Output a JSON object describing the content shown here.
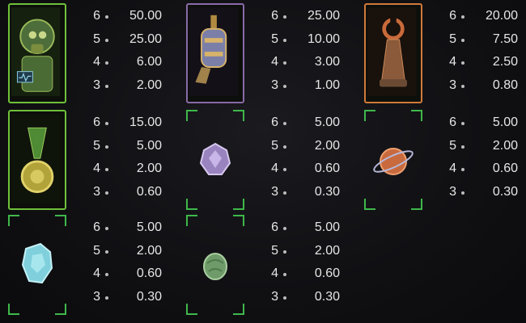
{
  "symbols": [
    {
      "name": "robot-diver",
      "pays": [
        {
          "count": "6",
          "value": "50.00"
        },
        {
          "count": "5",
          "value": "25.00"
        },
        {
          "count": "4",
          "value": "6.00"
        },
        {
          "count": "3",
          "value": "2.00"
        }
      ]
    },
    {
      "name": "lantern-device",
      "pays": [
        {
          "count": "6",
          "value": "25.00"
        },
        {
          "count": "5",
          "value": "10.00"
        },
        {
          "count": "4",
          "value": "3.00"
        },
        {
          "count": "3",
          "value": "1.00"
        }
      ]
    },
    {
      "name": "copper-tower",
      "pays": [
        {
          "count": "6",
          "value": "20.00"
        },
        {
          "count": "5",
          "value": "7.50"
        },
        {
          "count": "4",
          "value": "2.50"
        },
        {
          "count": "3",
          "value": "0.80"
        }
      ]
    },
    {
      "name": "green-medal",
      "pays": [
        {
          "count": "6",
          "value": "15.00"
        },
        {
          "count": "5",
          "value": "5.00"
        },
        {
          "count": "4",
          "value": "2.00"
        },
        {
          "count": "3",
          "value": "0.60"
        }
      ]
    },
    {
      "name": "purple-crystal",
      "pays": [
        {
          "count": "6",
          "value": "5.00"
        },
        {
          "count": "5",
          "value": "2.00"
        },
        {
          "count": "4",
          "value": "0.60"
        },
        {
          "count": "3",
          "value": "0.30"
        }
      ]
    },
    {
      "name": "orange-planet",
      "pays": [
        {
          "count": "6",
          "value": "5.00"
        },
        {
          "count": "5",
          "value": "2.00"
        },
        {
          "count": "4",
          "value": "0.60"
        },
        {
          "count": "3",
          "value": "0.30"
        }
      ]
    },
    {
      "name": "blue-crystal",
      "pays": [
        {
          "count": "6",
          "value": "5.00"
        },
        {
          "count": "5",
          "value": "2.00"
        },
        {
          "count": "4",
          "value": "0.60"
        },
        {
          "count": "3",
          "value": "0.30"
        }
      ]
    },
    {
      "name": "green-rock",
      "pays": [
        {
          "count": "6",
          "value": "5.00"
        },
        {
          "count": "5",
          "value": "2.00"
        },
        {
          "count": "4",
          "value": "0.60"
        },
        {
          "count": "3",
          "value": "0.30"
        }
      ]
    }
  ],
  "colors": {
    "frame_green": "#6fc13a",
    "frame_purple": "#8a6aa8",
    "frame_orange": "#d07a3a",
    "corner_green": "#3fb84a"
  }
}
